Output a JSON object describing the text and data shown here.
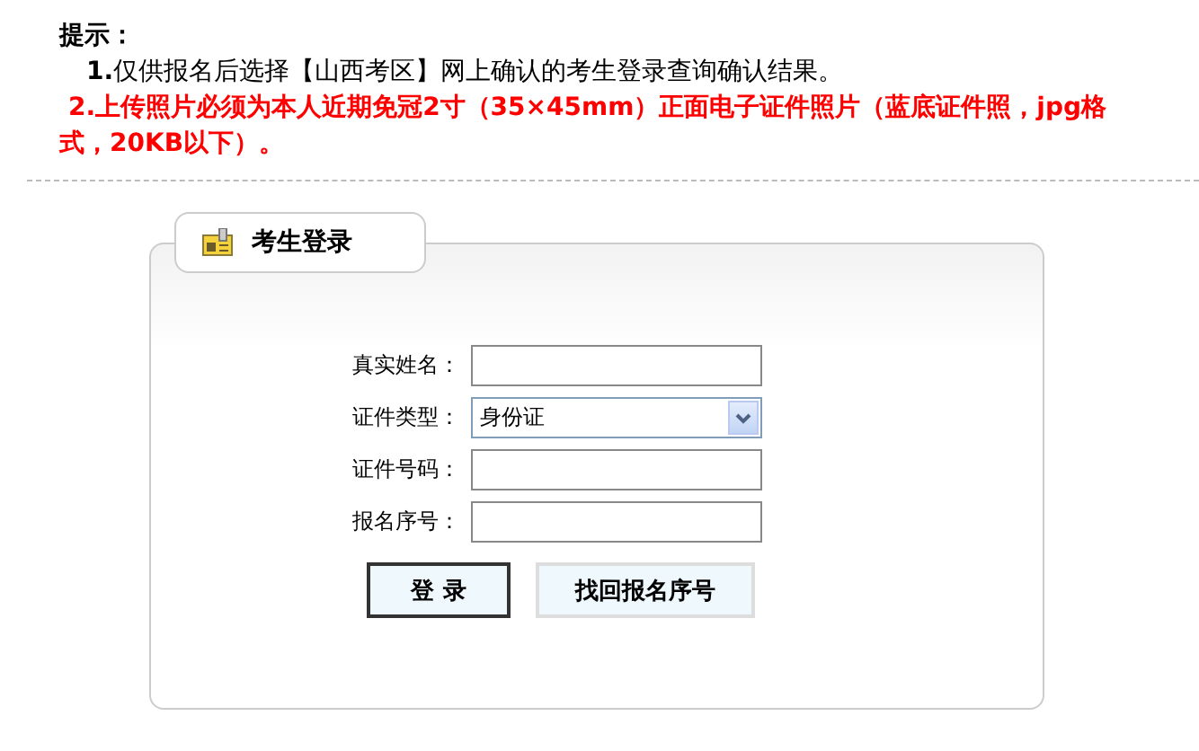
{
  "notice": {
    "title": "提示：",
    "items": [
      {
        "number": "1.",
        "text": "仅供报名后选择【山西考区】网上确认的考生登录查询确认结果。",
        "kind": "plain"
      },
      {
        "number": "2.",
        "text": "上传照片必须为本人近期免冠2寸（35×45mm）正面电子证件照片（蓝底证件照，jpg格式，20KB以下）。",
        "kind": "warning"
      }
    ]
  },
  "login_panel": {
    "title": "考生登录",
    "fields": [
      {
        "label": "真实姓名：",
        "kind": "text"
      },
      {
        "label": "证件类型：",
        "kind": "select",
        "value": "身份证"
      },
      {
        "label": "证件号码：",
        "kind": "text"
      },
      {
        "label": "报名序号：",
        "kind": "text"
      }
    ],
    "buttons": [
      {
        "label": "登 录",
        "kind": "primary"
      },
      {
        "label": "找回报名序号",
        "kind": "secondary"
      }
    ]
  }
}
